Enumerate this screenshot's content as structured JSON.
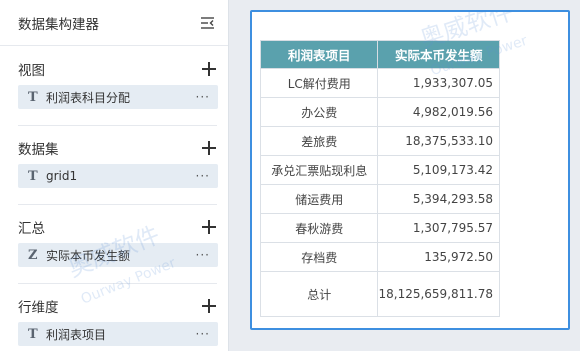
{
  "panel": {
    "title": "数据集构建器",
    "collapse_icon": "collapse-list-icon"
  },
  "sections": [
    {
      "label": "视图",
      "field": {
        "type": "T",
        "text": "利润表科目分配"
      }
    },
    {
      "label": "数据集",
      "field": {
        "type": "T",
        "text": "grid1"
      }
    },
    {
      "label": "汇总",
      "field": {
        "type": "Z",
        "text": "实际本币发生额"
      }
    },
    {
      "label": "行维度",
      "field": {
        "type": "T",
        "text": "利润表项目"
      }
    }
  ],
  "more_label": "···",
  "table": {
    "headers": [
      "利润表项目",
      "实际本币发生额"
    ],
    "rows": [
      {
        "name": "LC解付费用",
        "value": "1,933,307.05"
      },
      {
        "name": "办公费",
        "value": "4,982,019.56"
      },
      {
        "name": "差旅费",
        "value": "18,375,533.10"
      },
      {
        "name": "承兑汇票贴现利息",
        "value": "5,109,173.42"
      },
      {
        "name": "储运费用",
        "value": "5,394,293.58"
      },
      {
        "name": "春秋游费",
        "value": "1,307,795.57"
      },
      {
        "name": "存档费",
        "value": "135,972.50"
      }
    ],
    "total": {
      "name": "总计",
      "value": "18,125,659,811.78"
    }
  },
  "watermark": {
    "cn": "奥威软件",
    "en": "Ourway Power"
  },
  "colors": {
    "header_bg": "#5aa1ad",
    "selection_border": "#3d8fe0",
    "field_bg": "#e5ecf3"
  }
}
